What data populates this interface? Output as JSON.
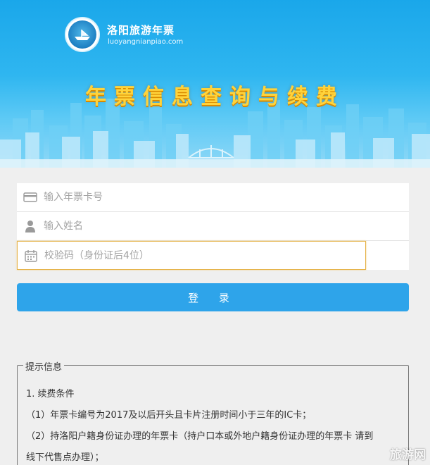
{
  "header": {
    "brand_name": "洛阳旅游年票",
    "brand_url": "luoyangnianpiao.com",
    "headline": "年票信息查询与续费",
    "logo_icon": "ship-seal-icon",
    "colors": {
      "banner": "#1aa7ea",
      "headline": "#ffd33b"
    }
  },
  "form": {
    "card_number": {
      "placeholder": "输入年票卡号",
      "icon": "card-icon"
    },
    "name": {
      "placeholder": "输入姓名",
      "icon": "person-icon"
    },
    "verify": {
      "placeholder": "校验码（身份证后4位）",
      "icon": "calendar-icon"
    },
    "login_label": "登  录",
    "accent": "#2ea4ea"
  },
  "tips": {
    "legend": "提示信息",
    "lines": [
      "1. 续费条件",
      "（1）年票卡编号为2017及以后开头且卡片注册时间小于三年的IC卡；",
      "（2）持洛阳户籍身份证办理的年票卡（持户口本或外地户籍身份证办理的年票卡 请到",
      "线下代售点办理）；"
    ]
  },
  "watermark": "旅游网"
}
